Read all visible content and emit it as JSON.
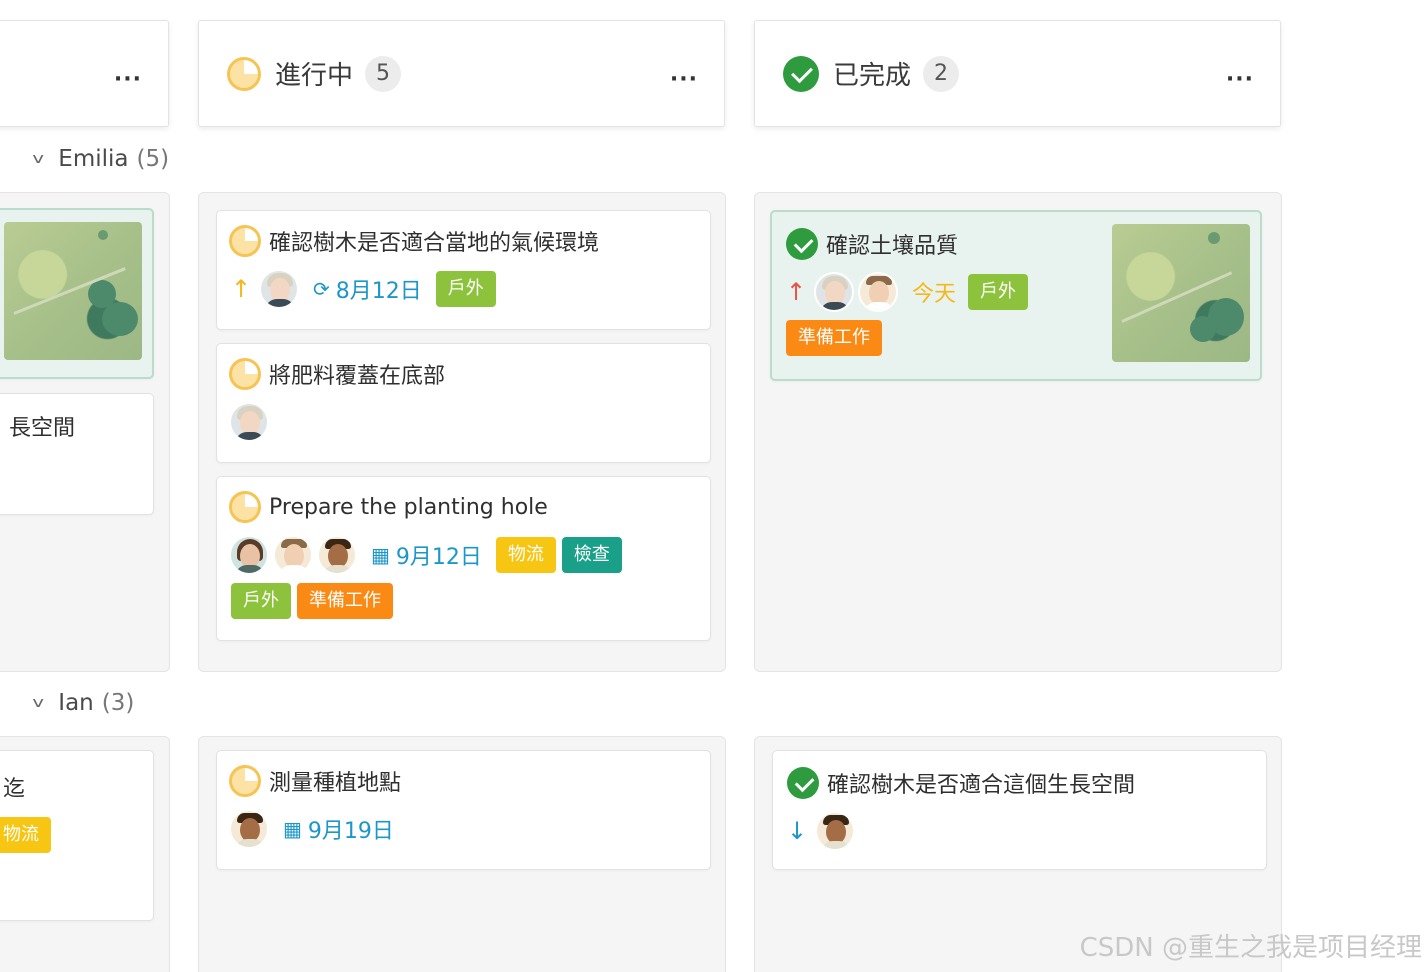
{
  "columns": {
    "partial": {
      "menu": "..."
    },
    "in_progress": {
      "title": "進行中",
      "count": "5",
      "menu": "..."
    },
    "done": {
      "title": "已完成",
      "count": "2",
      "menu": "..."
    }
  },
  "groups": [
    {
      "name": "Emilia",
      "count": "(5)"
    },
    {
      "name": "Ian",
      "count": "(3)"
    }
  ],
  "cards": {
    "left_partial_1_title": "長空間",
    "left_partial_2_title": "迄",
    "left_partial_2_tag": "物流",
    "ip1": {
      "title": "確認樹木是否適合當地的氣候環境",
      "date": "8月12日",
      "tags": [
        "戶外"
      ]
    },
    "ip2": {
      "title": "將肥料覆蓋在底部"
    },
    "ip3": {
      "title": "Prepare the planting hole",
      "date": "9月12日",
      "tags": [
        "物流",
        "檢查",
        "戶外",
        "準備工作"
      ]
    },
    "ip4": {
      "title": "測量種植地點",
      "date": "9月19日"
    },
    "d1": {
      "title": "確認土壤品質",
      "date": "今天",
      "tags": [
        "戶外",
        "準備工作"
      ]
    },
    "d2": {
      "title": "確認樹木是否適合這個生長空間"
    }
  },
  "icons": {
    "priority_up": "↑",
    "priority_down": "↓",
    "recurring": "⟳",
    "calendar": "▦",
    "chevron": "v"
  },
  "colors": {
    "date_blue": "#1d97c9",
    "done_green": "#2e9b3e",
    "progress_yellow": "#f6c453",
    "tag_green": "#8dc33c",
    "tag_yellow": "#f6c612",
    "tag_teal": "#1aa089",
    "tag_orange": "#fa8a14",
    "priority_high": "#e5534b",
    "priority_low": "#1d97c9"
  },
  "watermark": "CSDN @重生之我是项目经理"
}
